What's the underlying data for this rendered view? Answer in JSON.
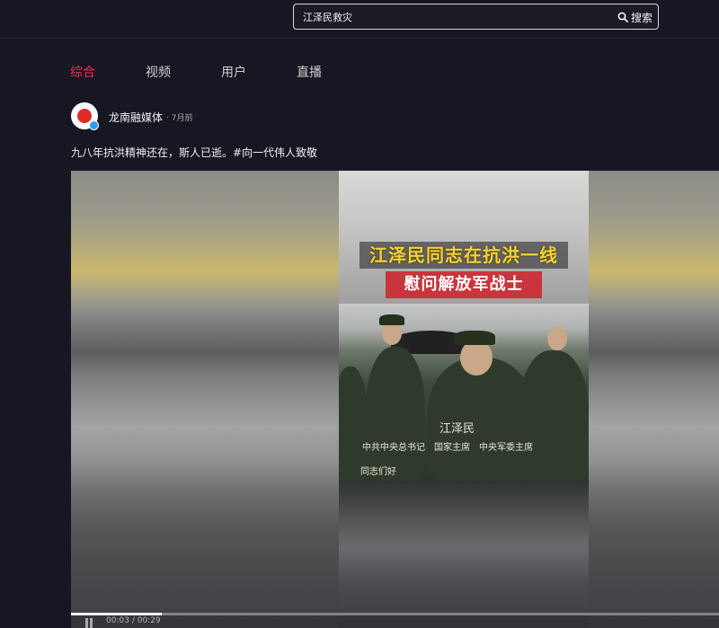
{
  "search": {
    "query": "江泽民救灾",
    "button_label": "搜索"
  },
  "tabs": [
    {
      "label": "综合",
      "active": true
    },
    {
      "label": "视频",
      "active": false
    },
    {
      "label": "用户",
      "active": false
    },
    {
      "label": "直播",
      "active": false
    }
  ],
  "post": {
    "author": "龙南融媒体",
    "time": "· 7月前",
    "text": "九八年抗洪精神还在，斯人已逝。#向一代伟人致敬",
    "video": {
      "headline_line1": "江泽民同志在抗洪一线",
      "headline_line2": "慰问解放军战士",
      "caption_name": "江泽民",
      "caption_titles": "中共中央总书记　国家主席　中央军委主席",
      "caption_greeting": "同志们好",
      "current_time": "00:03",
      "duration": "00:29",
      "progress": 0.14
    }
  },
  "colors": {
    "accent": "#fe2c55",
    "background": "#161722",
    "verified": "#2f9bff",
    "headline_yellow": "#f4d331",
    "headline_red": "#c8353c"
  }
}
